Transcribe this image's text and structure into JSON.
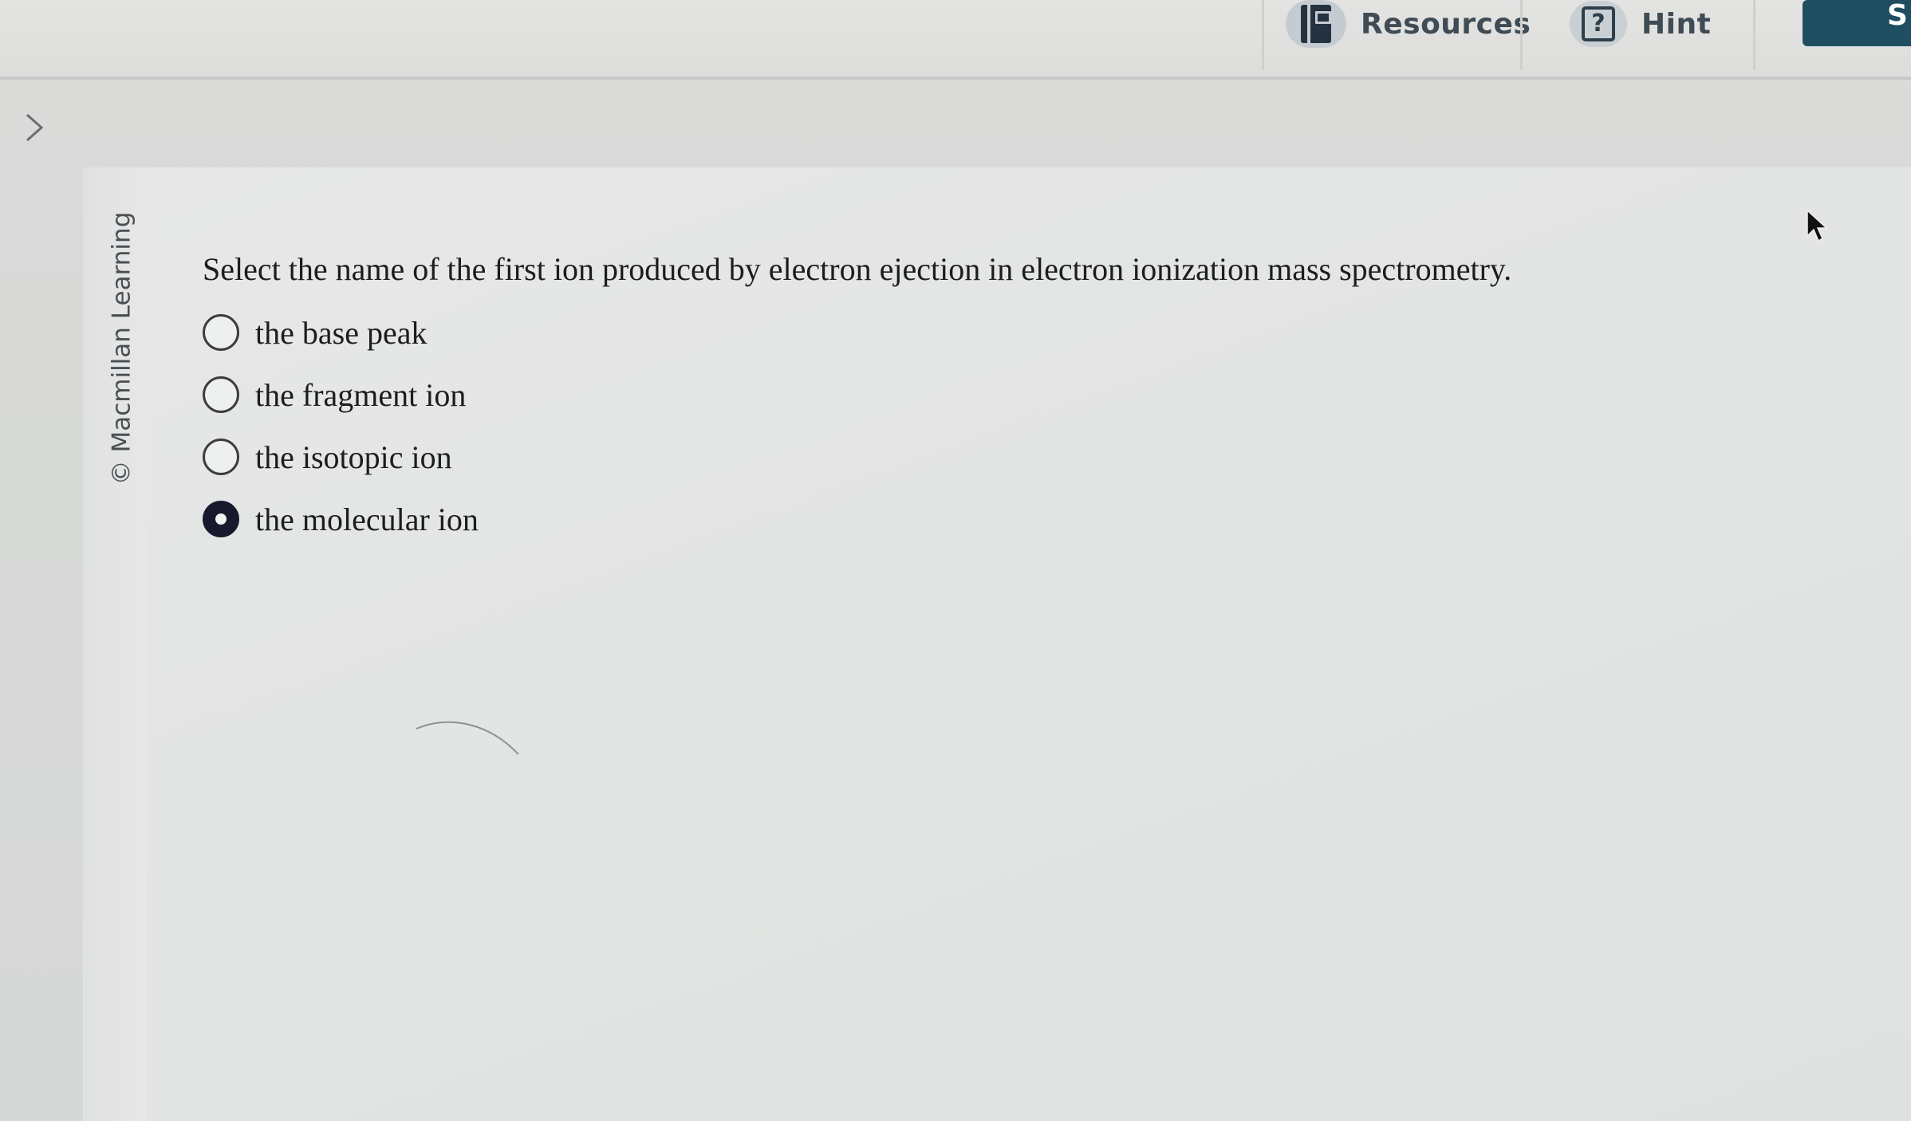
{
  "toolbar": {
    "resources_label": "Resources",
    "hint_label": "Hint",
    "submit_label": "S"
  },
  "sidebar": {
    "copyright_label": "© Macmillan Learning"
  },
  "question": {
    "prompt": "Select the name of the first ion produced by electron ejection in electron ionization mass spectrometry.",
    "options": [
      {
        "label": "the base peak",
        "selected": false
      },
      {
        "label": "the fragment ion",
        "selected": false
      },
      {
        "label": "the isotopic ion",
        "selected": false
      },
      {
        "label": "the molecular ion",
        "selected": true
      }
    ]
  },
  "colors": {
    "accent": "#1f4e60",
    "toolbar_text": "#3f4b55",
    "radio_selected": "#161a2c"
  },
  "icons": {
    "resources": "book-icon",
    "hint": "question-mark-icon",
    "nav": "chevron-right-icon",
    "pointer": "mouse-cursor-icon"
  }
}
